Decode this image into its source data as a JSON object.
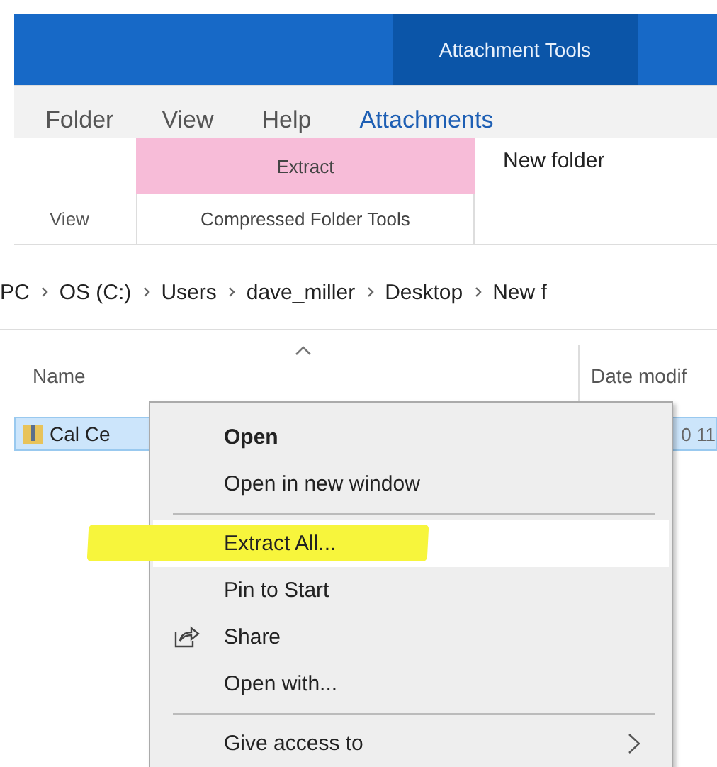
{
  "title_bar": {
    "contextual_tab": "Attachment Tools"
  },
  "menu_tabs": [
    {
      "label": "Folder",
      "selected": false
    },
    {
      "label": "View",
      "selected": false
    },
    {
      "label": "Help",
      "selected": false
    },
    {
      "label": "Attachments",
      "selected": true
    }
  ],
  "ribbon": {
    "group_tab": "Extract",
    "new_folder": "New folder",
    "view_tab": "View",
    "group_label": "Compressed Folder Tools"
  },
  "breadcrumb": [
    "PC",
    "OS (C:)",
    "Users",
    "dave_miller",
    "Desktop",
    "New f"
  ],
  "columns": [
    {
      "label": "Name",
      "sorted": true
    },
    {
      "label": "Date modif"
    }
  ],
  "files": [
    {
      "name": "Cal Ce",
      "date": "0 11",
      "selected": true
    }
  ],
  "context_menu": [
    {
      "kind": "item",
      "label": "Open",
      "default": true,
      "hovered": false,
      "highlighted": false,
      "share_icon": false
    },
    {
      "kind": "item",
      "label": "Open in new window",
      "default": false,
      "hovered": false,
      "highlighted": false,
      "share_icon": false
    },
    {
      "kind": "separator"
    },
    {
      "kind": "item",
      "label": "Extract All...",
      "default": false,
      "hovered": true,
      "highlighted": true,
      "share_icon": false
    },
    {
      "kind": "item",
      "label": "Pin to Start",
      "default": false,
      "hovered": false,
      "highlighted": false,
      "share_icon": false
    },
    {
      "kind": "item",
      "label": "Share",
      "default": false,
      "hovered": false,
      "highlighted": false,
      "share_icon": true
    },
    {
      "kind": "item",
      "label": "Open with...",
      "default": false,
      "hovered": false,
      "highlighted": false,
      "share_icon": false
    },
    {
      "kind": "separator"
    },
    {
      "kind": "submenu",
      "label": "Give access to",
      "default": false,
      "hovered": false,
      "highlighted": false,
      "share_icon": false
    }
  ]
}
